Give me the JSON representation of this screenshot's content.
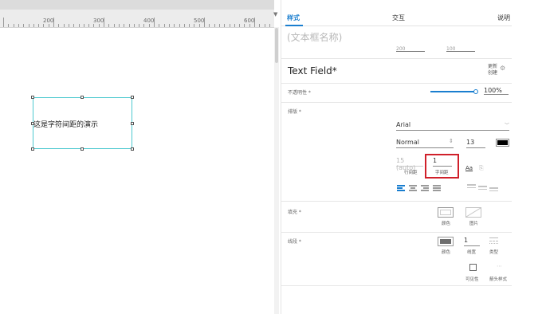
{
  "ruler": {
    "labels": [
      "200",
      "300",
      "400",
      "500",
      "600"
    ]
  },
  "canvas": {
    "demo_text": "这是字符间距的演示"
  },
  "tabs": [
    {
      "label": "样式"
    },
    {
      "label": "交互"
    },
    {
      "label": "说明"
    }
  ],
  "panel": {
    "name_placeholder": "(文本框名称)",
    "partial_fields": {
      "left": "200",
      "middle": "100"
    },
    "type_title": "Text Field*",
    "update_link": "更新",
    "create_link": "创建",
    "opacity": {
      "label": "不透明性 *",
      "value": "100%",
      "level": 1.0
    },
    "typography": {
      "label": "排版 *",
      "font": "Arial",
      "weight": "Normal",
      "size": "13",
      "color": "#000000",
      "line_height": {
        "value": "15 (auto)",
        "caption": "行间距"
      },
      "char_spacing": {
        "value": "1",
        "caption": "字间距"
      },
      "underline_icon": "Aa"
    },
    "fill": {
      "label": "填充 *",
      "color_caption": "颜色",
      "image_caption": "图片"
    },
    "border": {
      "label": "线段 *",
      "color_caption": "颜色",
      "width_value": "1",
      "width_caption": "线宽",
      "type_caption": "类型",
      "border_color": "#6e6e6e"
    },
    "visibility": {
      "caption": "可见性"
    },
    "arrow": {
      "caption": "箭头样式"
    }
  },
  "colors": {
    "accent": "#1a7ecf",
    "highlight": "#d0202a",
    "selection": "#4ec9d0"
  }
}
